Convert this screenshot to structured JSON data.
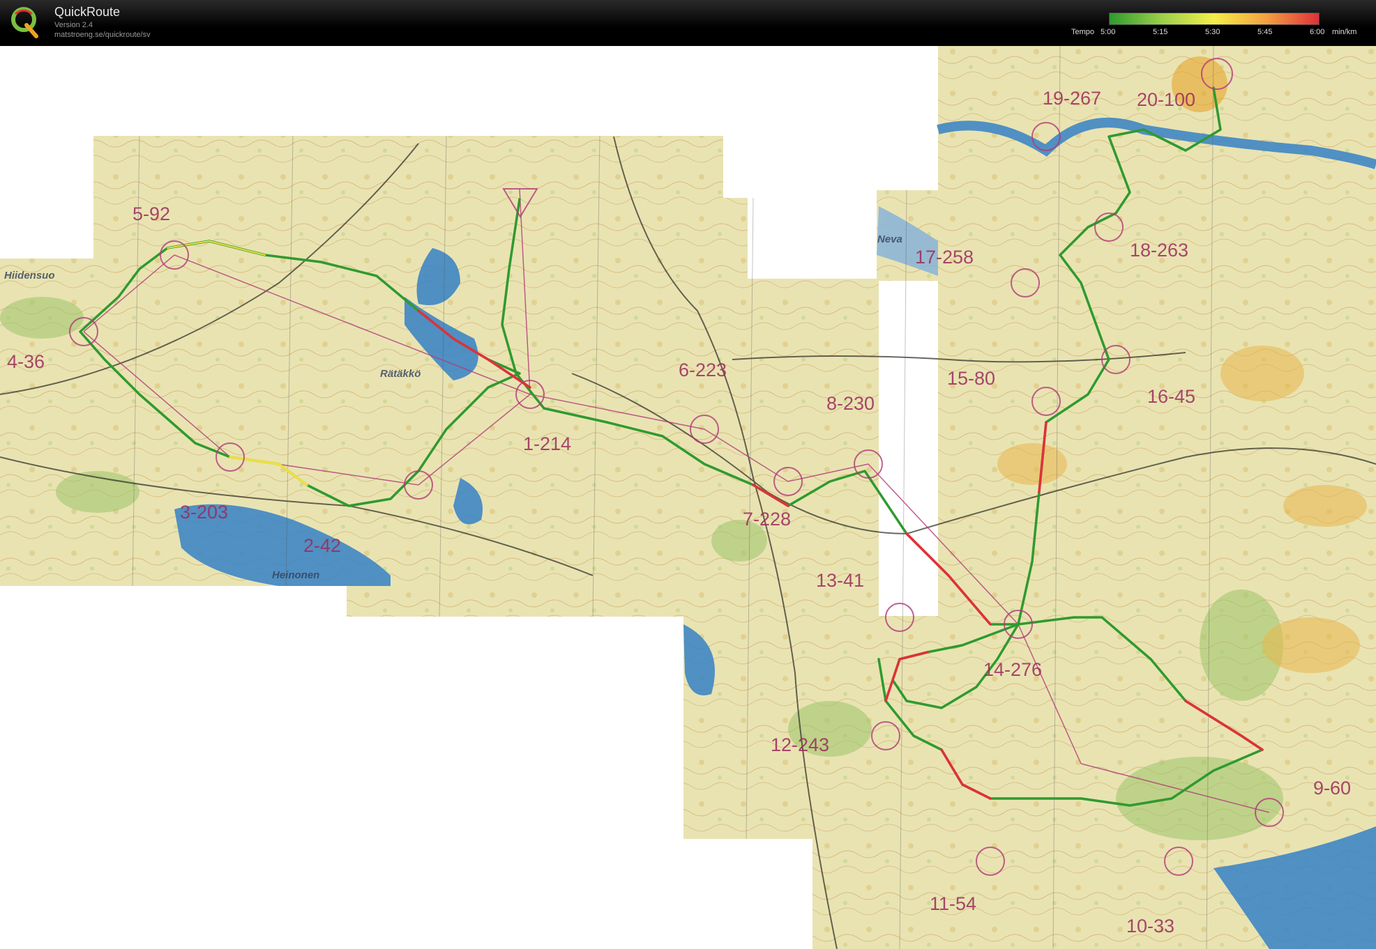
{
  "app": {
    "title": "QuickRoute",
    "version": "Version 2.4",
    "url": "matstroeng.se/quickroute/sv"
  },
  "legend": {
    "title": "Tempo",
    "unit": "min/km",
    "ticks": [
      "5:00",
      "5:15",
      "5:30",
      "5:45",
      "6:00"
    ],
    "gradient": [
      "#2f9a2f",
      "#9bd04a",
      "#f5ee4a",
      "#f2a040",
      "#e0303a"
    ]
  },
  "map": {
    "background_color": "#e9e3b2",
    "water_color": "#3f86c4",
    "route_colors": [
      "#2f9a2f",
      "#f0e040",
      "#e0303a"
    ],
    "control_color": "#b03a78",
    "place_names": [
      "Hiidensuo",
      "Rätäkkö",
      "Heinonen",
      "Neva"
    ],
    "control_labels": [
      "1-214",
      "2-42",
      "3-203",
      "4-36",
      "5-92",
      "6-223",
      "7-228",
      "8-230",
      "9-60",
      "10-33",
      "11-54",
      "12-243",
      "13-41",
      "14-276",
      "15-80",
      "16-45",
      "17-258",
      "18-263",
      "19-267",
      "20-100"
    ]
  }
}
